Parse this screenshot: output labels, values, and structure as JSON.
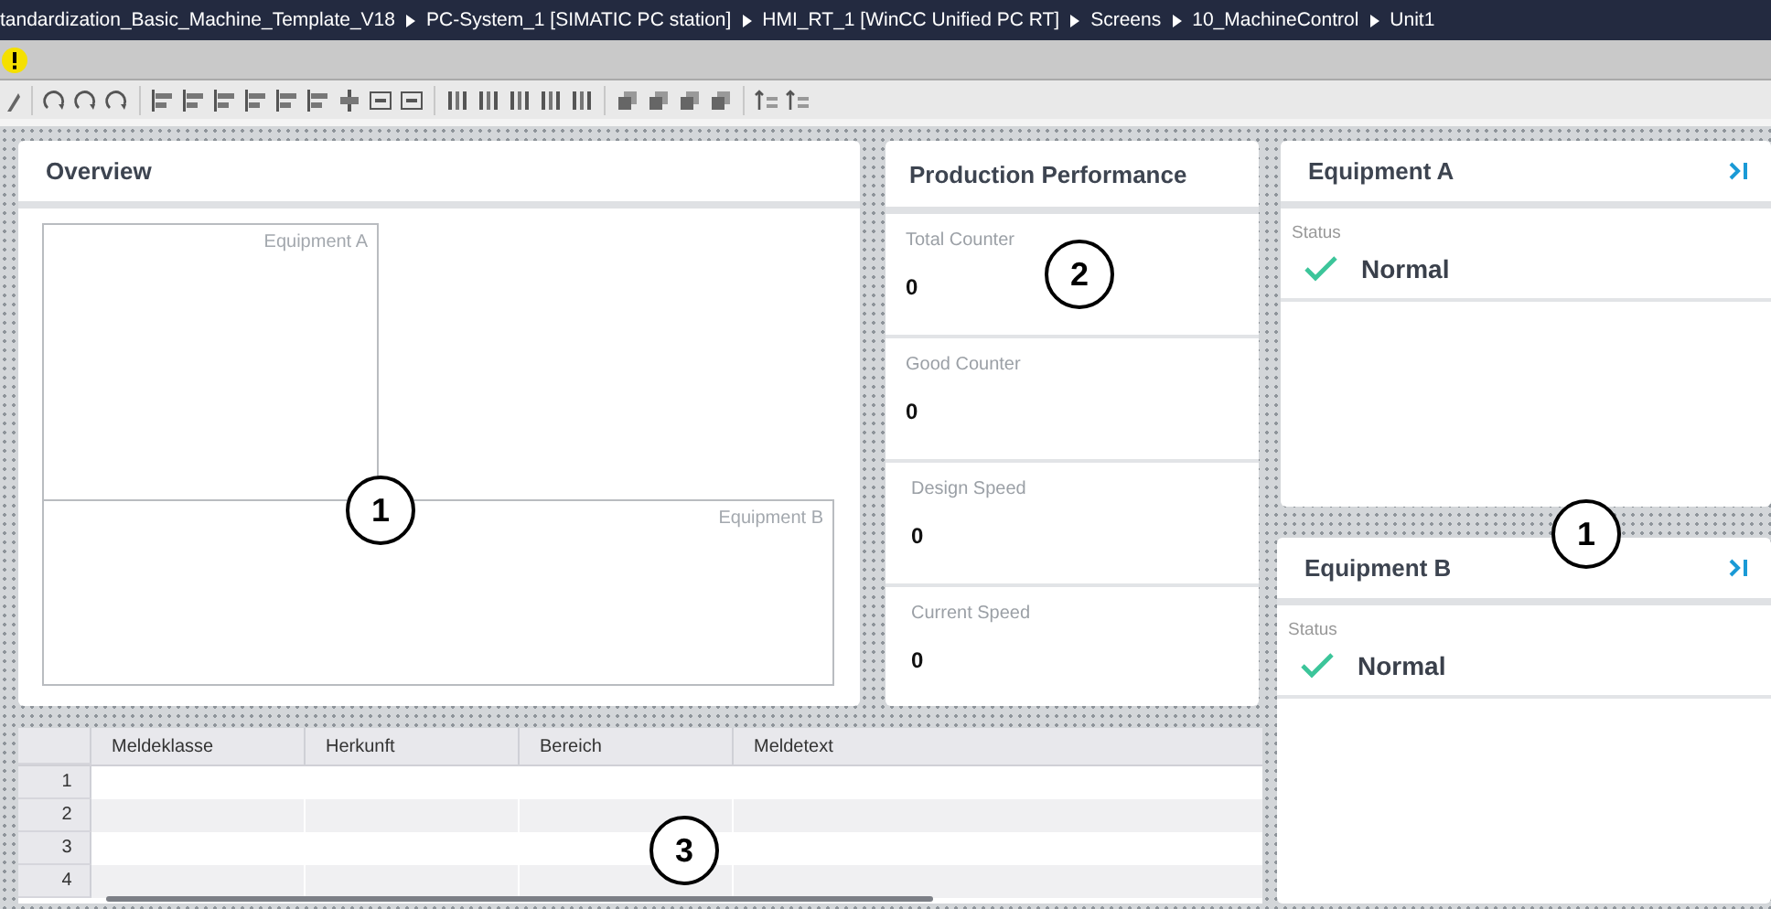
{
  "breadcrumb": [
    "tandardization_Basic_Machine_Template_V18",
    "PC-System_1 [SIMATIC PC station]",
    "HMI_RT_1 [WinCC Unified PC RT]",
    "Screens",
    "10_MachineControl",
    "Unit1"
  ],
  "overview": {
    "title": "Overview",
    "areas": [
      "Equipment A",
      "Equipment B"
    ]
  },
  "production": {
    "title": "Production Performance",
    "metrics": [
      {
        "label": "Total Counter",
        "value": "0"
      },
      {
        "label": "Good Counter",
        "value": "0"
      },
      {
        "label": "Design Speed",
        "value": "0"
      },
      {
        "label": "Current Speed",
        "value": "0"
      }
    ]
  },
  "equipment": [
    {
      "title": "Equipment A",
      "status_label": "Status",
      "status": "Normal",
      "ok": true
    },
    {
      "title": "Equipment B",
      "status_label": "Status",
      "status": "Normal",
      "ok": true
    }
  ],
  "alarm_table": {
    "columns": [
      "Meldeklasse",
      "Herkunft",
      "Bereich",
      "Meldetext"
    ],
    "row_numbers": [
      "1",
      "2",
      "3",
      "4"
    ]
  },
  "callouts": [
    "1",
    "2",
    "1",
    "3"
  ]
}
